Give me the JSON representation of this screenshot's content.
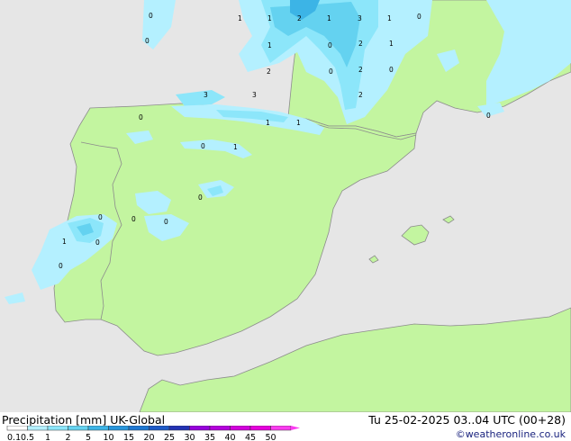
{
  "legend": {
    "title": "Precipitation [mm]",
    "model": "UK-Global",
    "ticks": [
      "0.1",
      "0.5",
      "1",
      "2",
      "5",
      "10",
      "15",
      "20",
      "25",
      "30",
      "35",
      "40",
      "45",
      "50"
    ],
    "colors": [
      "#ffffff",
      "#b4f0ff",
      "#8ce6fa",
      "#64d2f0",
      "#3cb4e6",
      "#2896dc",
      "#1e78d2",
      "#1e5ac8",
      "#2332b4",
      "#9600dc",
      "#b400dc",
      "#d200dc",
      "#e600dc",
      "#fa3cf0"
    ]
  },
  "valid_time": "Tu 25-02-2025 03..04 UTC (00+28)",
  "credit": "©weatheronline.co.uk",
  "map": {
    "land_color": "#c3f5a0",
    "sea_color": "#e6e6e6",
    "border_color": "#8c8c8c",
    "labels": [
      "0",
      "1",
      "1",
      "2",
      "1",
      "3",
      "1",
      "0",
      "0",
      "1",
      "0",
      "2",
      "1",
      "2",
      "0",
      "2",
      "0",
      "3",
      "2",
      "3",
      "0",
      "0",
      "1",
      "1",
      "0",
      "1",
      "0",
      "0",
      "0",
      "0",
      "1",
      "0",
      "0"
    ]
  }
}
